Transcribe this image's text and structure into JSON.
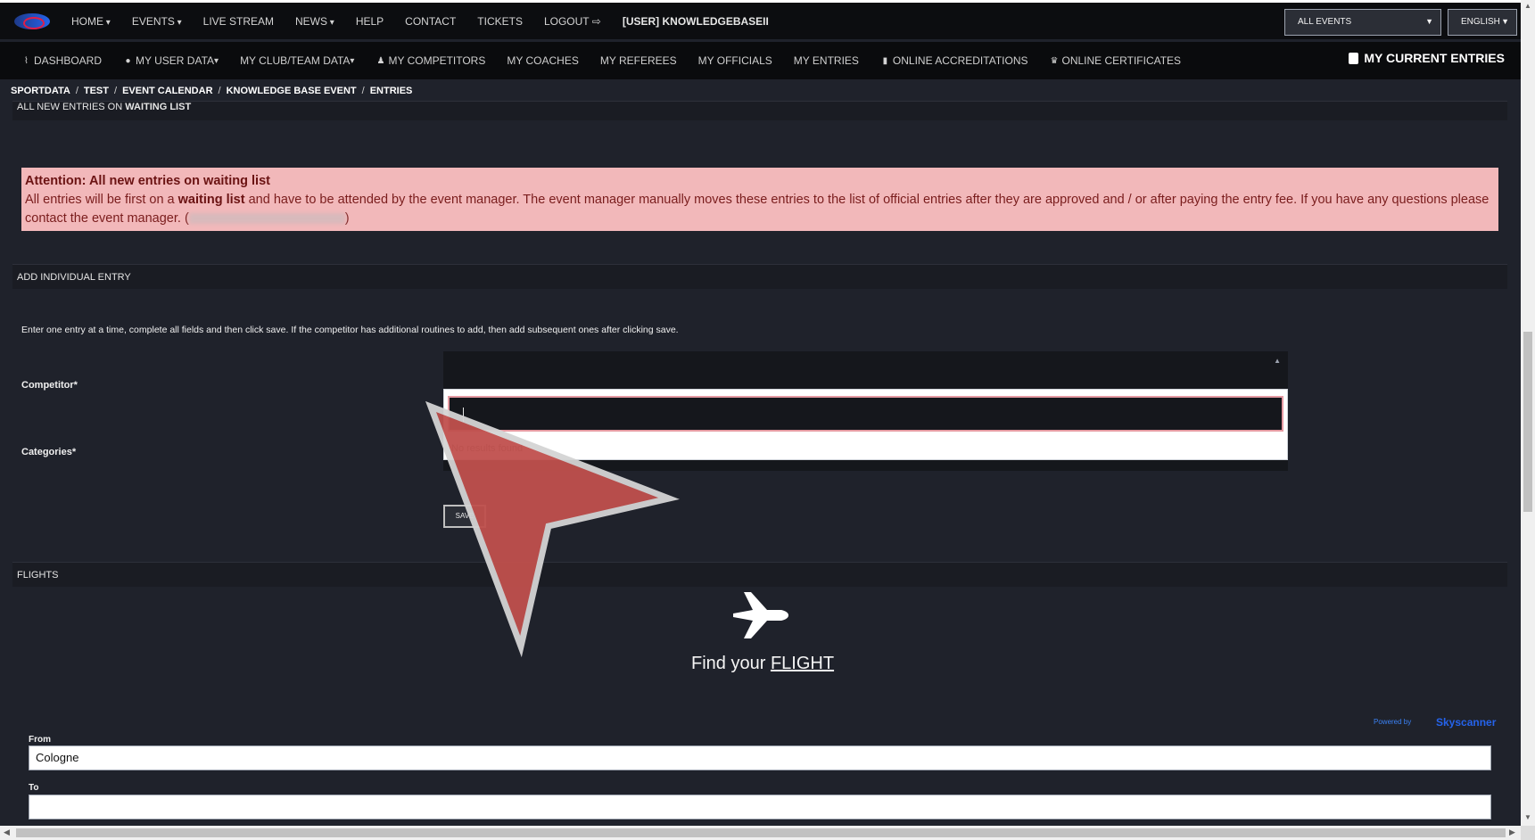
{
  "topnav": {
    "items": [
      "HOME",
      "EVENTS",
      "LIVE STREAM",
      "NEWS",
      "HELP",
      "CONTACT",
      "TICKETS",
      "LOGOUT",
      "[USER] KNOWLEDGEBASEII"
    ],
    "events_select": "ALL EVENTS",
    "language_select": "ENGLISH"
  },
  "subnav": {
    "items": [
      "DASHBOARD",
      "MY USER DATA",
      "MY CLUB/TEAM DATA",
      "MY COMPETITORS",
      "MY COACHES",
      "MY REFEREES",
      "MY OFFICIALS",
      "MY ENTRIES",
      "ONLINE ACCREDITATIONS",
      "ONLINE CERTIFICATES"
    ],
    "current_entries": "MY CURRENT ENTRIES"
  },
  "breadcrumb": [
    "SPORTDATA",
    "TEST",
    "EVENT CALENDAR",
    "KNOWLEDGE BASE EVENT",
    "ENTRIES"
  ],
  "waiting_section": {
    "head_prefix": "ALL NEW ENTRIES ON ",
    "head_bold": "WAITING LIST"
  },
  "alert": {
    "title": "Attention: All new entries on waiting list",
    "text_a": "All entries will be first on a ",
    "text_bold": "waiting list",
    "text_b": " and have to be attended by the event manager. The event manager manually moves these entries to the list of official entries after they are approved and / or after paying the entry fee. If you have any questions please contact the event manager.",
    "paren_open": "(",
    "paren_close": ")"
  },
  "individual_entry": {
    "head": "ADD INDIVIDUAL ENTRY",
    "intro": "Enter one entry at a time, complete all fields and then click save. If the competitor has additional routines to add, then add subsequent ones after clicking save.",
    "competitor_label": "Competitor*",
    "categories_label": "Categories*",
    "search_value": "",
    "no_results": "No results found",
    "save_label": "SAVE"
  },
  "flights": {
    "head": "FLIGHTS",
    "find_prefix": "Find your ",
    "find_link": "FLIGHT",
    "powered_by": "Powered by",
    "provider": "Skyscanner",
    "from_label": "From",
    "from_value": "Cologne",
    "to_label": "To",
    "to_value": ""
  },
  "colors": {
    "alert_bg": "#f2b8ba",
    "cursor_fill": "#c0504d",
    "link_blue": "#2563eb"
  },
  "icons": [
    "chart-line-icon",
    "user-circle-icon",
    "user-icon",
    "id-badge-icon",
    "trophy-icon",
    "clipboard-icon",
    "plane-icon",
    "logout-icon",
    "caret-down-icon",
    "pointer-cursor-icon"
  ]
}
